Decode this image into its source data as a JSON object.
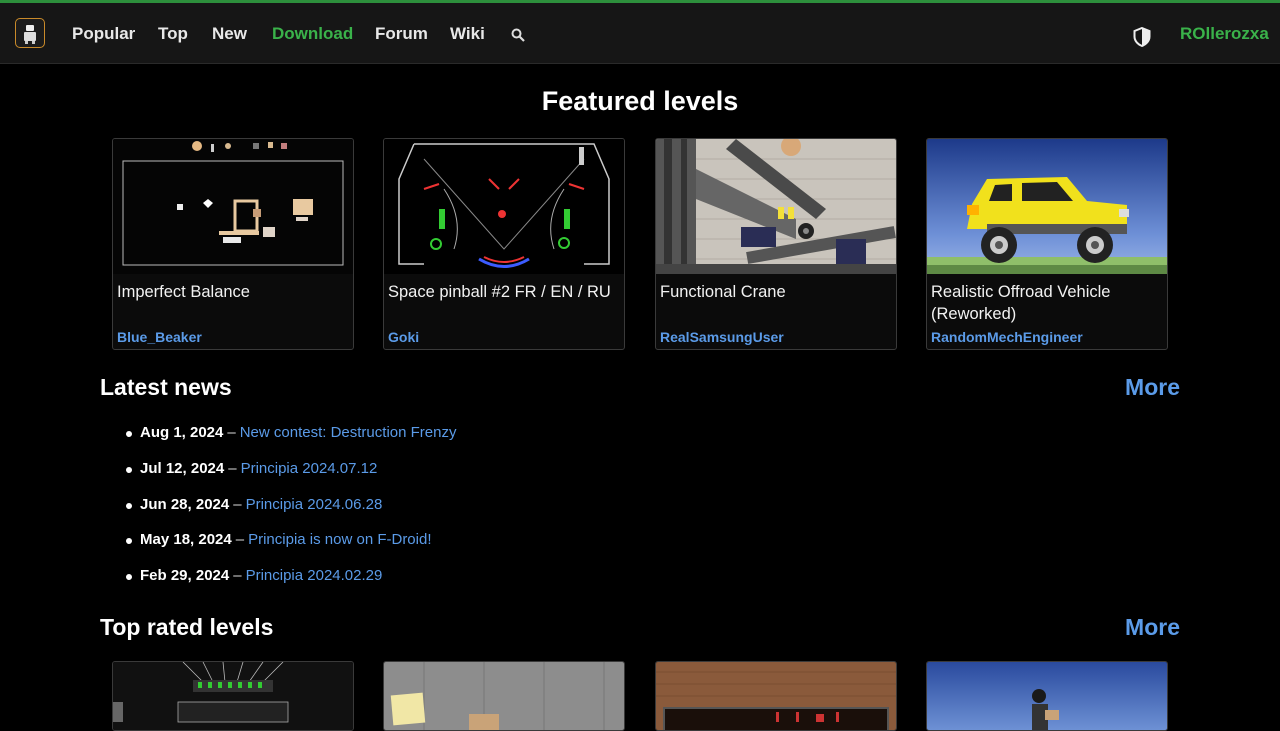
{
  "nav": {
    "items": [
      {
        "label": "Popular",
        "active": false
      },
      {
        "label": "Top",
        "active": false
      },
      {
        "label": "New",
        "active": false
      },
      {
        "label": "Download",
        "active": true
      },
      {
        "label": "Forum",
        "active": false
      },
      {
        "label": "Wiki",
        "active": false
      }
    ],
    "search_icon": "search-icon",
    "theme_icon": "shield-half-icon",
    "username": "ROllerozxa",
    "accent_color": "#3ab24a"
  },
  "featured": {
    "title": "Featured levels",
    "levels": [
      {
        "title": "Imperfect Balance",
        "author": "Blue_Beaker"
      },
      {
        "title": "Space pinball #2 FR / EN / RU",
        "author": "Goki"
      },
      {
        "title": "Functional Crane",
        "author": "RealSamsungUser"
      },
      {
        "title": "Realistic Offroad Vehicle (Reworked)",
        "author": "RandomMechEngineer"
      }
    ]
  },
  "news": {
    "title": "Latest news",
    "more_label": "More",
    "items": [
      {
        "date": "Aug 1, 2024",
        "link": "New contest: Destruction Frenzy"
      },
      {
        "date": "Jul 12, 2024",
        "link": "Principia 2024.07.12"
      },
      {
        "date": "Jun 28, 2024",
        "link": "Principia 2024.06.28"
      },
      {
        "date": "May 18, 2024",
        "link": "Principia is now on F-Droid!"
      },
      {
        "date": "Feb 29, 2024",
        "link": "Principia 2024.02.29"
      }
    ],
    "separator": "–"
  },
  "top_rated": {
    "title": "Top rated levels",
    "more_label": "More"
  },
  "link_color": "#5b9be8"
}
